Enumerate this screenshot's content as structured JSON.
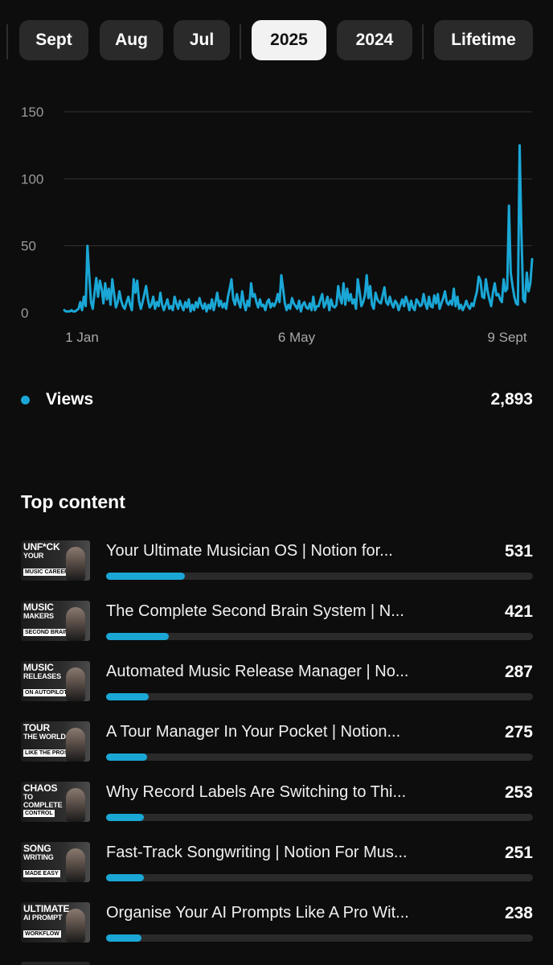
{
  "colors": {
    "accent": "#1aa7d6",
    "background": "#0d0d0d"
  },
  "tabs": [
    {
      "label": "Sept",
      "active": false
    },
    {
      "label": "Aug",
      "active": false
    },
    {
      "label": "Jul",
      "active": false
    },
    {
      "label": "2025",
      "active": true
    },
    {
      "label": "2024",
      "active": false
    },
    {
      "label": "Lifetime",
      "active": false
    }
  ],
  "chart_data": {
    "type": "line",
    "title": "",
    "xlabel": "",
    "ylabel": "",
    "yticks": [
      "0",
      "50",
      "100",
      "150"
    ],
    "ylim": [
      0,
      150
    ],
    "xticks": [
      "1 Jan",
      "6 May",
      "9 Sept"
    ],
    "grid": true,
    "series": [
      {
        "name": "Views",
        "color": "#1aa7d6",
        "x_start": "1 Jan",
        "x_end": "9 Sept",
        "values": [
          2,
          1,
          1,
          1,
          2,
          1,
          1,
          2,
          3,
          8,
          2,
          12,
          5,
          50,
          28,
          8,
          3,
          15,
          26,
          12,
          24,
          18,
          7,
          22,
          10,
          18,
          6,
          25,
          14,
          4,
          8,
          16,
          9,
          5,
          3,
          8,
          12,
          6,
          2,
          25,
          15,
          24,
          9,
          3,
          8,
          14,
          20,
          10,
          4,
          6,
          12,
          3,
          8,
          5,
          15,
          6,
          2,
          6,
          10,
          3,
          5,
          2,
          12,
          7,
          3,
          9,
          5,
          2,
          8,
          4,
          10,
          1,
          6,
          2,
          8,
          4,
          11,
          6,
          3,
          7,
          1,
          6,
          3,
          10,
          2,
          8,
          15,
          5,
          9,
          4,
          7,
          3,
          12,
          18,
          25,
          10,
          6,
          14,
          8,
          4,
          16,
          7,
          2,
          9,
          5,
          22,
          12,
          14,
          8,
          4,
          10,
          5,
          6,
          2,
          8,
          10,
          4,
          7,
          5,
          8,
          14,
          8,
          28,
          18,
          7,
          2,
          6,
          3,
          11,
          7,
          5,
          3,
          9,
          1,
          6,
          8,
          4,
          3,
          7,
          2,
          12,
          2,
          5,
          5,
          10,
          14,
          4,
          7,
          12,
          2,
          10,
          5,
          4,
          6,
          20,
          11,
          7,
          22,
          6,
          18,
          9,
          14,
          7,
          10,
          3,
          25,
          16,
          5,
          8,
          13,
          28,
          11,
          20,
          6,
          3,
          15,
          10,
          8,
          7,
          13,
          19,
          8,
          6,
          12,
          7,
          4,
          9,
          7,
          2,
          6,
          10,
          5,
          12,
          8,
          2,
          9,
          4,
          2,
          10,
          8,
          5,
          6,
          14,
          7,
          3,
          12,
          5,
          4,
          13,
          7,
          14,
          3,
          7,
          11,
          16,
          8,
          6,
          9,
          6,
          18,
          5,
          12,
          3,
          6,
          2,
          5,
          9,
          5,
          3,
          7,
          5,
          11,
          16,
          27,
          24,
          12,
          11,
          25,
          16,
          10,
          5,
          15,
          22,
          13,
          14,
          10,
          8,
          25,
          16,
          18,
          80,
          30,
          20,
          12,
          7,
          6,
          125,
          60,
          10,
          8,
          30,
          16,
          22,
          40
        ]
      }
    ]
  },
  "metric": {
    "label": "Views",
    "value": "2,893"
  },
  "top_content": {
    "title": "Top content",
    "items": [
      {
        "thumb_lines": [
          "UNF*CK",
          "YOUR"
        ],
        "thumb_tag": "MUSIC CAREER",
        "title": "Your Ultimate Musician OS | Notion for...",
        "value": "531",
        "bar": 0.185
      },
      {
        "thumb_lines": [
          "MUSIC",
          "MAKERS"
        ],
        "thumb_tag": "SECOND BRAIN",
        "title": "The Complete Second Brain System | N...",
        "value": "421",
        "bar": 0.147
      },
      {
        "thumb_lines": [
          "MUSIC",
          "RELEASES"
        ],
        "thumb_tag": "ON AUTOPILOT",
        "title": "Automated Music Release Manager | No...",
        "value": "287",
        "bar": 0.1
      },
      {
        "thumb_lines": [
          "TOUR",
          "THE WORLD"
        ],
        "thumb_tag": "LIKE THE PROS",
        "title": "A Tour Manager In Your Pocket | Notion...",
        "value": "275",
        "bar": 0.096
      },
      {
        "thumb_lines": [
          "CHAOS",
          "TO COMPLETE"
        ],
        "thumb_tag": "CONTROL",
        "title": "Why Record Labels Are Switching to Thi...",
        "value": "253",
        "bar": 0.088
      },
      {
        "thumb_lines": [
          "SONG",
          "WRITING"
        ],
        "thumb_tag": "MADE EASY",
        "title": "Fast-Track Songwriting | Notion For Mus...",
        "value": "251",
        "bar": 0.088
      },
      {
        "thumb_lines": [
          "ULTIMATE",
          "AI PROMPT"
        ],
        "thumb_tag": "WORKFLOW",
        "title": "Organise Your AI Prompts Like A Pro Wit...",
        "value": "238",
        "bar": 0.083
      }
    ]
  }
}
